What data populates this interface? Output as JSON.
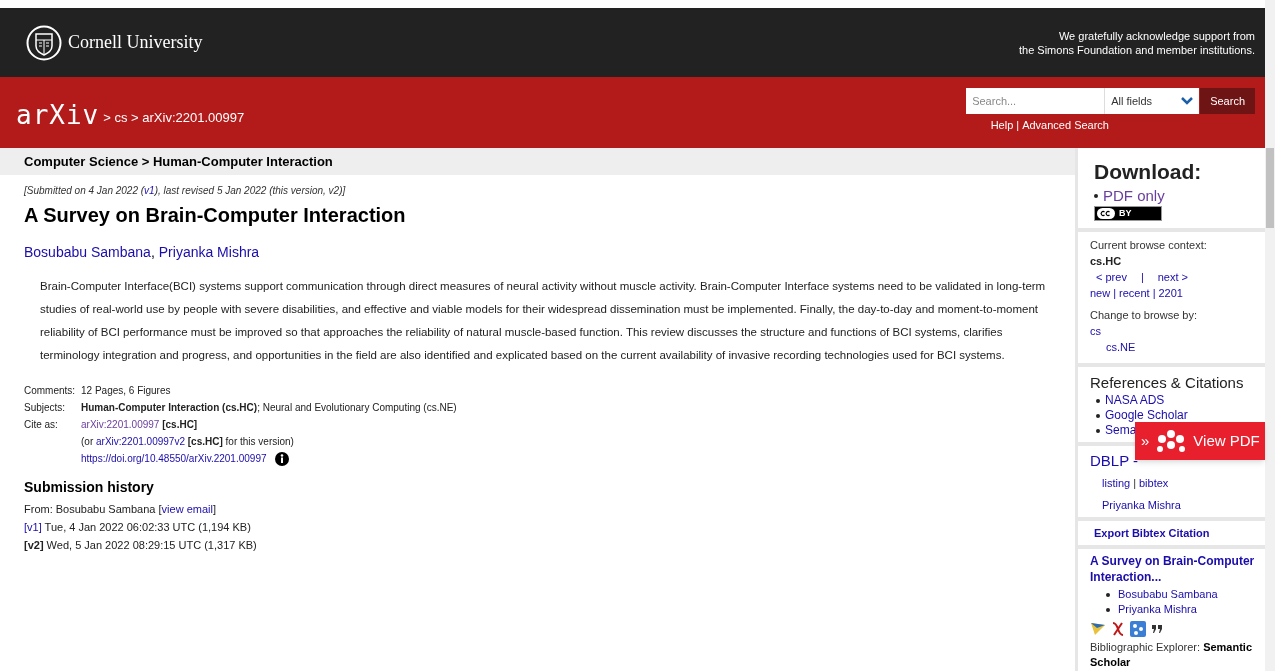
{
  "header": {
    "institution": "Cornell University",
    "acknowledgement": [
      "We gratefully acknowledge support from",
      "the Simons Foundation and member institutions."
    ]
  },
  "nav": {
    "logo": "arXiv",
    "breadcrumb": "> cs > arXiv:2201.00997",
    "search": {
      "placeholder": "Search...",
      "field": "All fields",
      "button": "Search"
    },
    "help_links": [
      "Help",
      "Advanced Search"
    ],
    "separator": "|"
  },
  "subheader": "Computer Science > Human-Computer Interaction",
  "submitted": [
    {
      "text": "[Submitted on 4 Jan 2022 (",
      "kind": "text"
    },
    {
      "text": "v1",
      "kind": "link"
    },
    {
      "text": "), last revised 5 Jan 2022 (this version, v2)]",
      "kind": "text"
    }
  ],
  "title": "A Survey on Brain-Computer Interaction",
  "authors": [
    "Bosubabu Sambana",
    "Priyanka Mishra"
  ],
  "author_separator": ",",
  "abstract": "Brain-Computer Interface(BCI) systems support communication through direct measures of neural activity without muscle activity. Brain-Computer Interface systems need to be validated in long-term studies of real-world use by people with severe disabilities, and effective and viable models for their widespread dissemination must be implemented. Finally, the day-to-day and moment-to-moment reliability of BCI performance must be improved so that approaches the reliability of natural muscle-based function. This review discusses the structure and functions of BCI systems, clarifies terminology integration and progress, and opportunities in the field are also identified and explicated based on the current availability of invasive recording technologies used for BCI systems.",
  "metadata": [
    {
      "label": "Comments:",
      "lines": [
        [
          {
            "text": "12 Pages, 6 Figures",
            "kind": "text"
          }
        ]
      ]
    },
    {
      "label": "Subjects:",
      "lines": [
        [
          {
            "text": "Human-Computer Interaction (cs.HC)",
            "kind": "bold"
          },
          {
            "text": "; Neural and Evolutionary Computing (cs.NE)",
            "kind": "text"
          }
        ]
      ]
    },
    {
      "label": "Cite as:",
      "lines": [
        [
          {
            "text": "arXiv:2201.00997",
            "kind": "visited"
          },
          {
            "text": " [cs.HC]",
            "kind": "bold"
          }
        ],
        [
          {
            "text": "(or ",
            "kind": "text"
          },
          {
            "text": "arXiv:2201.00997v2",
            "kind": "link"
          },
          {
            "text": " [cs.HC]",
            "kind": "bold"
          },
          {
            "text": " for this version)",
            "kind": "text"
          }
        ],
        [
          {
            "text": "https://doi.org/10.48550/arXiv.2201.00997",
            "kind": "link"
          },
          {
            "kind": "info"
          }
        ]
      ]
    }
  ],
  "history": {
    "title": "Submission history",
    "lines": [
      [
        {
          "text": "From: Bosubabu Sambana [",
          "kind": "text"
        },
        {
          "text": "view email",
          "kind": "link"
        },
        {
          "text": "]",
          "kind": "text"
        }
      ],
      [
        {
          "text": "[v1]",
          "kind": "link"
        },
        {
          "text": " Tue, 4 Jan 2022 06:02:33 UTC (1,194 KB)",
          "kind": "text"
        }
      ],
      [
        {
          "text": "[v2]",
          "kind": "bold"
        },
        {
          "text": " Wed, 5 Jan 2022 08:29:15 UTC (1,317 KB)",
          "kind": "text"
        }
      ]
    ]
  },
  "sidebar": {
    "download": {
      "title": "Download:",
      "items": [
        {
          "label": "PDF only",
          "visited": true
        }
      ],
      "license": "BY"
    },
    "browse": {
      "label": "Current browse context:",
      "context": "cs.HC",
      "prev": "< prev",
      "separator": "|",
      "next": "next >",
      "links": [
        "new",
        "recent",
        "2201"
      ],
      "change_label": "Change to browse by:",
      "categories": [
        {
          "label": "cs",
          "children": [
            {
              "label": "cs.NE"
            }
          ]
        }
      ]
    },
    "references": {
      "title": "References & Citations",
      "items": [
        "NASA ADS",
        "Google Scholar",
        "Sema"
      ]
    },
    "dblp": {
      "title": "DBLP -",
      "links": [
        "listing",
        "bibtex"
      ],
      "separator": "|",
      "author": "Priyanka Mishra"
    },
    "export": "Export Bibtex Citation",
    "scholar": {
      "title": "A Survey on Brain-Computer Interaction...",
      "authors": [
        "Bosubabu Sambana",
        "Priyanka Mishra"
      ],
      "explorer_label": "Bibliographic Explorer: ",
      "explorer_value": "Semantic Scholar"
    }
  },
  "overlay": {
    "label": "View PDF",
    "chevrons": "»"
  }
}
